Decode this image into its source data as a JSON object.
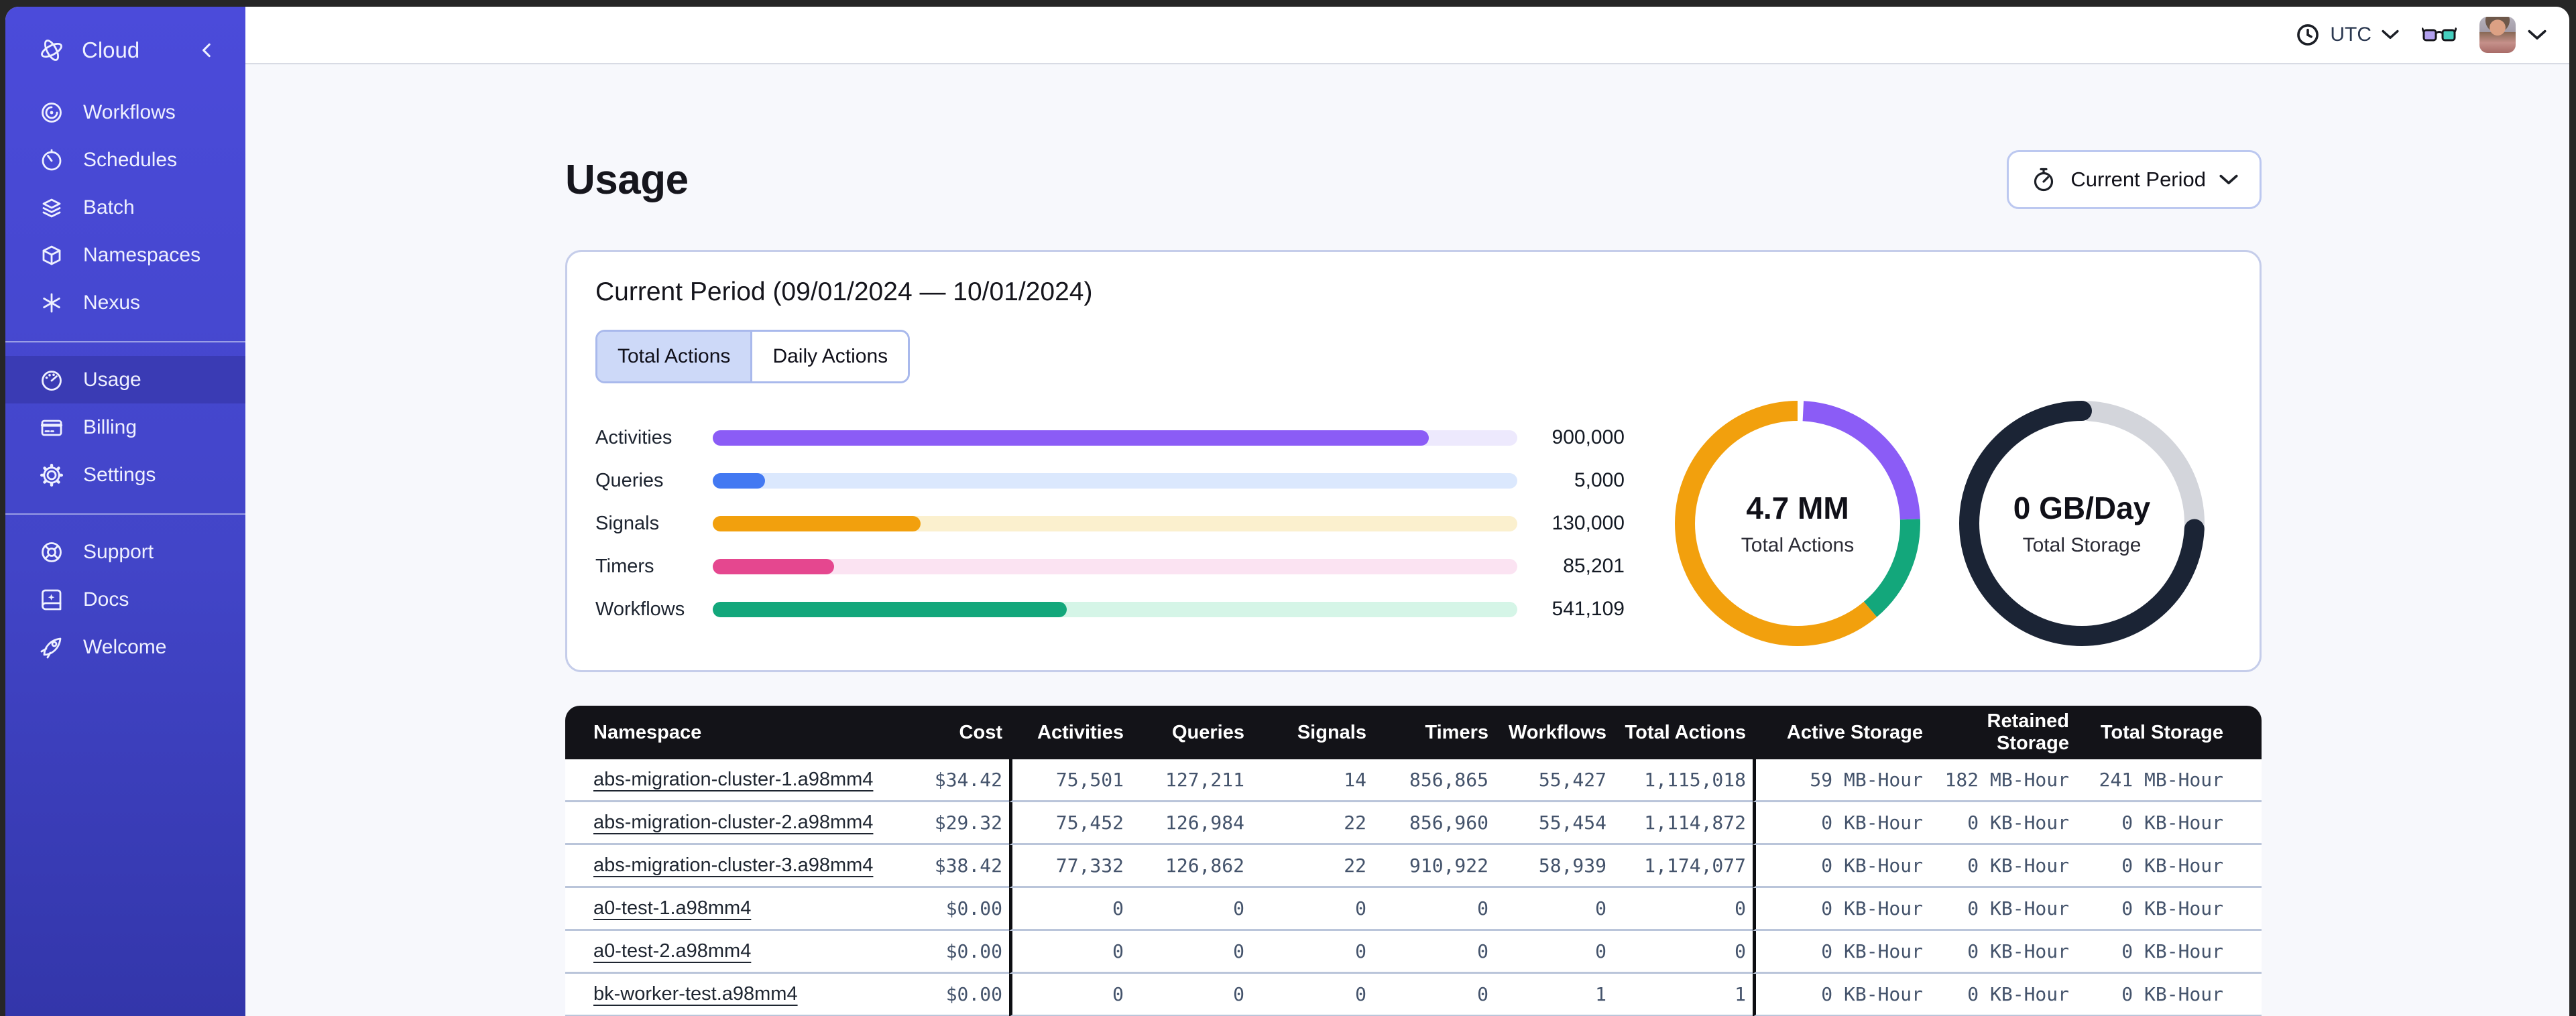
{
  "sidebar": {
    "brand": {
      "label": "Cloud",
      "icon": "orbit-icon",
      "collapse_icon": "chevron-left-icon"
    },
    "groups": [
      {
        "items": [
          {
            "id": "workflows",
            "label": "Workflows",
            "icon": "workflows-icon",
            "active": false
          },
          {
            "id": "schedules",
            "label": "Schedules",
            "icon": "schedules-icon",
            "active": false
          },
          {
            "id": "batch",
            "label": "Batch",
            "icon": "batch-icon",
            "active": false
          },
          {
            "id": "namespaces",
            "label": "Namespaces",
            "icon": "namespaces-icon",
            "active": false
          },
          {
            "id": "nexus",
            "label": "Nexus",
            "icon": "nexus-icon",
            "active": false
          }
        ]
      },
      {
        "items": [
          {
            "id": "usage",
            "label": "Usage",
            "icon": "gauge-icon",
            "active": true
          },
          {
            "id": "billing",
            "label": "Billing",
            "icon": "credit-card-icon",
            "active": false
          },
          {
            "id": "settings",
            "label": "Settings",
            "icon": "gear-icon",
            "active": false
          }
        ]
      },
      {
        "items": [
          {
            "id": "support",
            "label": "Support",
            "icon": "lifebuoy-icon",
            "active": false
          },
          {
            "id": "docs",
            "label": "Docs",
            "icon": "book-icon",
            "active": false
          },
          {
            "id": "welcome",
            "label": "Welcome",
            "icon": "rocket-icon",
            "active": false
          }
        ]
      }
    ]
  },
  "topbar": {
    "timezone": "UTC"
  },
  "page": {
    "title": "Usage",
    "period_button_label": "Current Period"
  },
  "usage_card": {
    "title": "Current Period (09/01/2024 — 10/01/2024)",
    "tabs": [
      {
        "label": "Total Actions",
        "active": true
      },
      {
        "label": "Daily Actions",
        "active": false
      }
    ],
    "bars": [
      {
        "label": "Activities",
        "value": "900,000",
        "fraction": 0.89,
        "color": "#8B5CF6",
        "track": "#EDE9FD"
      },
      {
        "label": "Queries",
        "value": "5,000",
        "fraction": 0.065,
        "color": "#4379F2",
        "track": "#DBE8FD"
      },
      {
        "label": "Signals",
        "value": "130,000",
        "fraction": 0.258,
        "color": "#F2A00D",
        "track": "#FBF0CE"
      },
      {
        "label": "Timers",
        "value": "85,201",
        "fraction": 0.151,
        "color": "#E5478F",
        "track": "#FBE3F2"
      },
      {
        "label": "Workflows",
        "value": "541,109",
        "fraction": 0.44,
        "color": "#13A77B",
        "track": "#D5F5E7"
      }
    ],
    "donuts": [
      {
        "value": "4.7 MM",
        "label": "Total Actions",
        "rotation": 0.008,
        "linecap": "butt",
        "segments": [
          {
            "name": "activities",
            "color": "#8B5CF6",
            "fraction": 0.236
          },
          {
            "name": "workflows",
            "color": "#13A77B",
            "fraction": 0.144
          },
          {
            "name": "other",
            "color": "#F2A00D",
            "fraction": 0.62
          }
        ]
      },
      {
        "value": "0 GB/Day",
        "label": "Total Storage",
        "rotation": 0.011,
        "linecap": "round",
        "segments": [
          {
            "name": "free",
            "color": "#D3D5DB",
            "fraction": 0.247
          },
          {
            "name": "used",
            "color": "#1B2435",
            "fraction": 0.753
          }
        ]
      }
    ]
  },
  "table": {
    "columns": [
      {
        "label": "Namespace",
        "align": "left"
      },
      {
        "label": "Cost",
        "align": "right"
      },
      {
        "label": "Activities",
        "align": "right",
        "divider_before": true
      },
      {
        "label": "Queries",
        "align": "right"
      },
      {
        "label": "Signals",
        "align": "right"
      },
      {
        "label": "Timers",
        "align": "right"
      },
      {
        "label": "Workflows",
        "align": "right"
      },
      {
        "label": "Total Actions",
        "align": "right"
      },
      {
        "label": "Active Storage",
        "align": "right",
        "divider_before": true
      },
      {
        "label": "Retained Storage",
        "align": "right"
      },
      {
        "label": "Total Storage",
        "align": "right"
      }
    ],
    "rows": [
      {
        "namespace": "abs-migration-cluster-1.a98mm4",
        "cells": [
          "$34.42",
          "75,501",
          "127,211",
          "14",
          "856,865",
          "55,427",
          "1,115,018",
          "59 MB-Hour",
          "182 MB-Hour",
          "241 MB-Hour"
        ]
      },
      {
        "namespace": "abs-migration-cluster-2.a98mm4",
        "cells": [
          "$29.32",
          "75,452",
          "126,984",
          "22",
          "856,960",
          "55,454",
          "1,114,872",
          "0 KB-Hour",
          "0 KB-Hour",
          "0 KB-Hour"
        ]
      },
      {
        "namespace": "abs-migration-cluster-3.a98mm4",
        "cells": [
          "$38.42",
          "77,332",
          "126,862",
          "22",
          "910,922",
          "58,939",
          "1,174,077",
          "0 KB-Hour",
          "0 KB-Hour",
          "0 KB-Hour"
        ]
      },
      {
        "namespace": "a0-test-1.a98mm4",
        "cells": [
          "$0.00",
          "0",
          "0",
          "0",
          "0",
          "0",
          "0",
          "0 KB-Hour",
          "0 KB-Hour",
          "0 KB-Hour"
        ]
      },
      {
        "namespace": "a0-test-2.a98mm4",
        "cells": [
          "$0.00",
          "0",
          "0",
          "0",
          "0",
          "0",
          "0",
          "0 KB-Hour",
          "0 KB-Hour",
          "0 KB-Hour"
        ]
      },
      {
        "namespace": "bk-worker-test.a98mm4",
        "cells": [
          "$0.00",
          "0",
          "0",
          "0",
          "0",
          "1",
          "1",
          "0 KB-Hour",
          "0 KB-Hour",
          "0 KB-Hour"
        ]
      }
    ]
  }
}
